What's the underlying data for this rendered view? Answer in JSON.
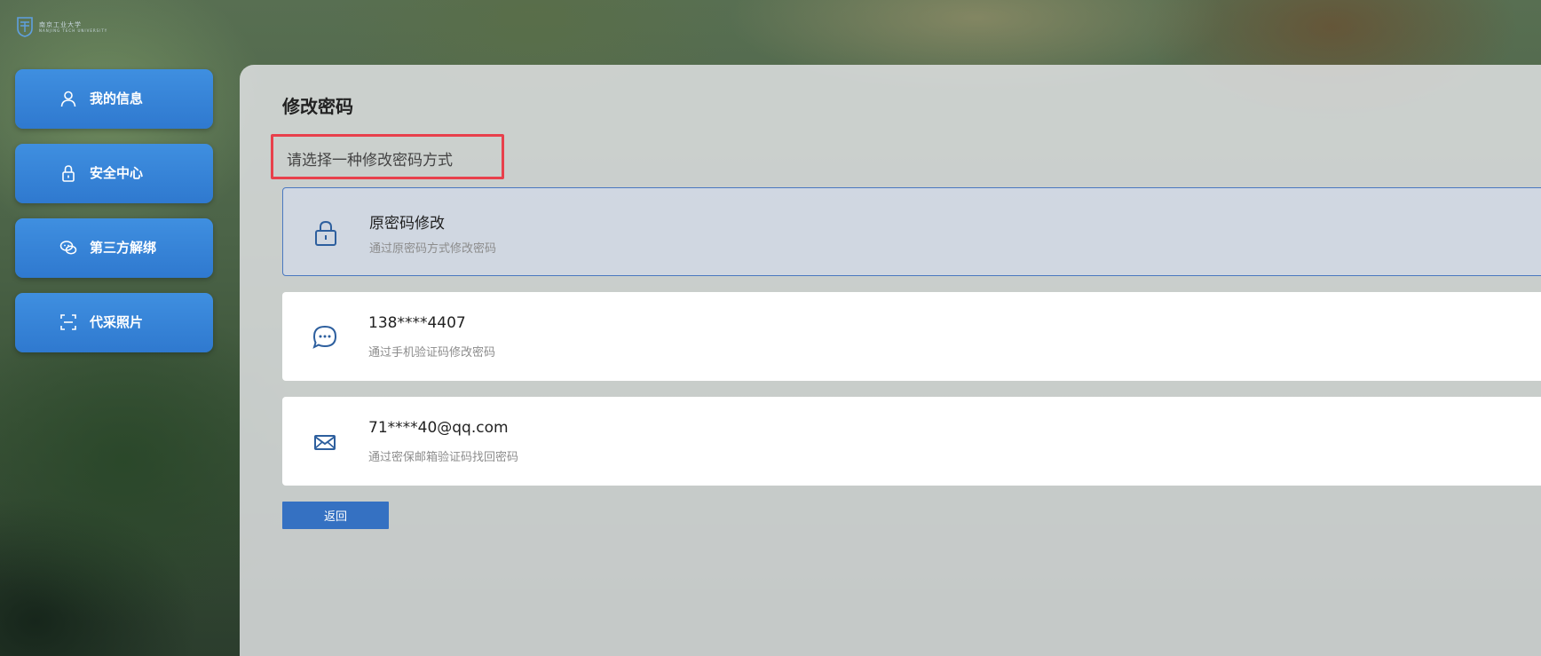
{
  "logo": {
    "text": "南京工业大学",
    "subtext": "NANJING TECH UNIVERSITY"
  },
  "sidebar": {
    "items": [
      {
        "label": "我的信息",
        "icon": "user-icon"
      },
      {
        "label": "安全中心",
        "icon": "lock-icon"
      },
      {
        "label": "第三方解绑",
        "icon": "wechat-icon"
      },
      {
        "label": "代采照片",
        "icon": "scan-icon"
      }
    ]
  },
  "main": {
    "title": "修改密码",
    "hint": "请选择一种修改密码方式",
    "options": [
      {
        "title": "原密码修改",
        "desc": "通过原密码方式修改密码",
        "icon": "lock-icon",
        "selected": true
      },
      {
        "title": "138****4407",
        "desc": "通过手机验证码修改密码",
        "icon": "chat-bubble-icon",
        "selected": false
      },
      {
        "title": "71****40@qq.com",
        "desc": "通过密保邮箱验证码找回密码",
        "icon": "mail-icon",
        "selected": false
      }
    ],
    "back_label": "返回"
  },
  "colors": {
    "sidebar_button": "#2f79cf",
    "primary": "#3571c2",
    "highlight_border": "#e8404b",
    "icon_blue": "#2d5f9e"
  }
}
